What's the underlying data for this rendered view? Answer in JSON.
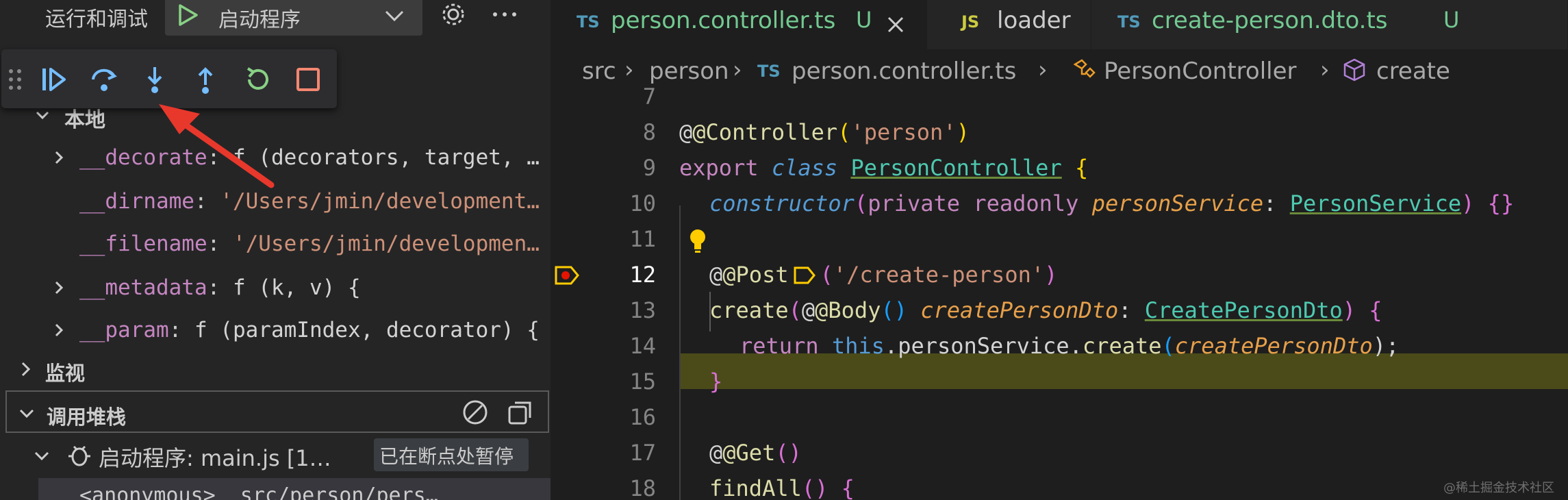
{
  "sidebar": {
    "title": "运行和调试",
    "config_label": "启动程序",
    "icons": {
      "play": "play-icon",
      "chevron": "chevron-down-icon",
      "gear": "gear-icon",
      "more": "more-icon"
    },
    "debug_toolbar": [
      "continue-icon",
      "step-over-icon",
      "step-into-icon",
      "step-out-icon",
      "restart-icon",
      "stop-icon"
    ],
    "scope_local": "本地",
    "variables": [
      {
        "name": "__decorate",
        "value": "f (decorators, target, …",
        "expandable": true
      },
      {
        "name": "__dirname",
        "value": "'/Users/jmin/development…",
        "expandable": false
      },
      {
        "name": "__filename",
        "value": "'/Users/jmin/developmen…",
        "expandable": false
      },
      {
        "name": "__metadata",
        "value": "f (k, v) {",
        "expandable": true
      },
      {
        "name": "__param",
        "value": "f (paramIndex, decorator) {",
        "expandable": true
      }
    ],
    "watch_label": "监视",
    "callstack_label": "调用堆栈",
    "thread": {
      "label": "启动程序: main.js [1…",
      "status": "已在断点处暂停"
    },
    "frame": {
      "label": "<anonymous>  src/person/pers…"
    }
  },
  "editor": {
    "tabs": [
      {
        "icon": "TS",
        "label": "person.controller.ts",
        "mark": "U",
        "active": true
      },
      {
        "icon": "JS",
        "label": "loader",
        "mark": "",
        "active": false
      },
      {
        "icon": "TS",
        "label": "create-person.dto.ts",
        "mark": "U",
        "active": false
      }
    ],
    "breadcrumb": [
      "src",
      "person",
      "person.controller.ts",
      "PersonController",
      "create"
    ],
    "breadcrumb_icon": "TS",
    "lines": [
      "7",
      "8",
      "9",
      "10",
      "11",
      "12",
      "13",
      "14",
      "15",
      "16",
      "17",
      "18"
    ],
    "current_line": "12",
    "code": {
      "l8": [
        "@Controller",
        "(",
        "'person'",
        ")"
      ],
      "l9": [
        "export ",
        "class ",
        "PersonController",
        " {"
      ],
      "l10": [
        "constructor",
        "(",
        "private ",
        "readonly ",
        "personService",
        ": ",
        "PersonService",
        ") {}"
      ],
      "l12": [
        "@Post",
        "(",
        "'/create-person'",
        ")"
      ],
      "l13": [
        "create",
        "(",
        "@Body",
        "() ",
        "createPersonDto",
        ": ",
        "CreatePersonDto",
        ") {"
      ],
      "l14": [
        "return ",
        "this",
        ".personService.",
        "create",
        "(",
        "createPersonDto",
        ");"
      ],
      "l15": [
        "}"
      ],
      "l17": [
        "@Get",
        "()"
      ],
      "l18": [
        "findAll",
        "() {"
      ]
    }
  },
  "watermark": "@稀土掘金技术社区",
  "colors": {
    "sidebar_bg": "#252526",
    "editor_bg": "#1e1e1e",
    "current_line_bg": "#4b4b1a",
    "breakpoint": "#e51400",
    "arrow": "#e8382c"
  }
}
